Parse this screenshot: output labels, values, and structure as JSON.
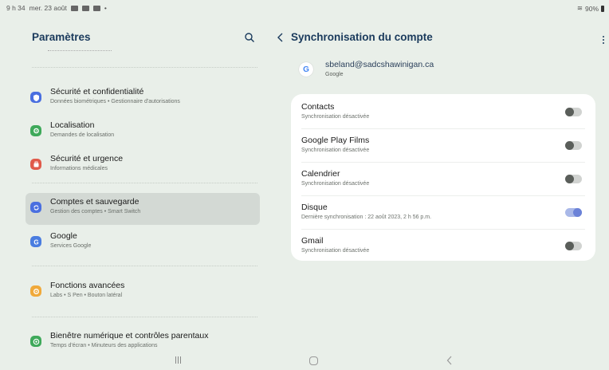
{
  "status": {
    "time": "9 h 34",
    "date": "mer. 23 août",
    "battery": "90%"
  },
  "left": {
    "title": "Paramètres",
    "items": [
      {
        "title": "Sécurité et confidentialité",
        "sub": "Données biométriques  •  Gestionnaire d'autorisations",
        "icon": "shield-icon",
        "color": "#4a6fe0"
      },
      {
        "title": "Localisation",
        "sub": "Demandes de localisation",
        "icon": "location-pin-icon",
        "color": "#3ea95a"
      },
      {
        "title": "Sécurité et urgence",
        "sub": "Informations médicales",
        "icon": "emergency-icon",
        "color": "#e05a4a"
      },
      {
        "title": "Comptes et sauvegarde",
        "sub": "Gestion des comptes  •  Smart Switch",
        "icon": "sync-icon",
        "color": "#4a6fe0"
      },
      {
        "title": "Google",
        "sub": "Services Google",
        "icon": "google-icon",
        "color": "#4a7de0"
      },
      {
        "title": "Fonctions avancées",
        "sub": "Labs  •  S Pen  •  Bouton latéral",
        "icon": "star-gear-icon",
        "color": "#f0a93a"
      },
      {
        "title": "Bienêtre numérique et contrôles parentaux",
        "sub": "Temps d'écran  •  Minuteurs des applications",
        "icon": "wellbeing-icon",
        "color": "#3ea95a"
      }
    ]
  },
  "right": {
    "title": "Synchronisation du compte",
    "account": {
      "email": "sbeland@sadcshawinigan.ca",
      "type": "Google",
      "logo": "G"
    },
    "rows": [
      {
        "title": "Contacts",
        "sub": "Synchronisation désactivée",
        "enabled": false
      },
      {
        "title": "Google Play Films",
        "sub": "Synchronisation désactivée",
        "enabled": false
      },
      {
        "title": "Calendrier",
        "sub": "Synchronisation désactivée",
        "enabled": false
      },
      {
        "title": "Disque",
        "sub": "Dernière synchronisation : 22 août 2023, 2 h 56 p.m.",
        "enabled": true
      },
      {
        "title": "Gmail",
        "sub": "Synchronisation désactivée",
        "enabled": false
      }
    ]
  }
}
